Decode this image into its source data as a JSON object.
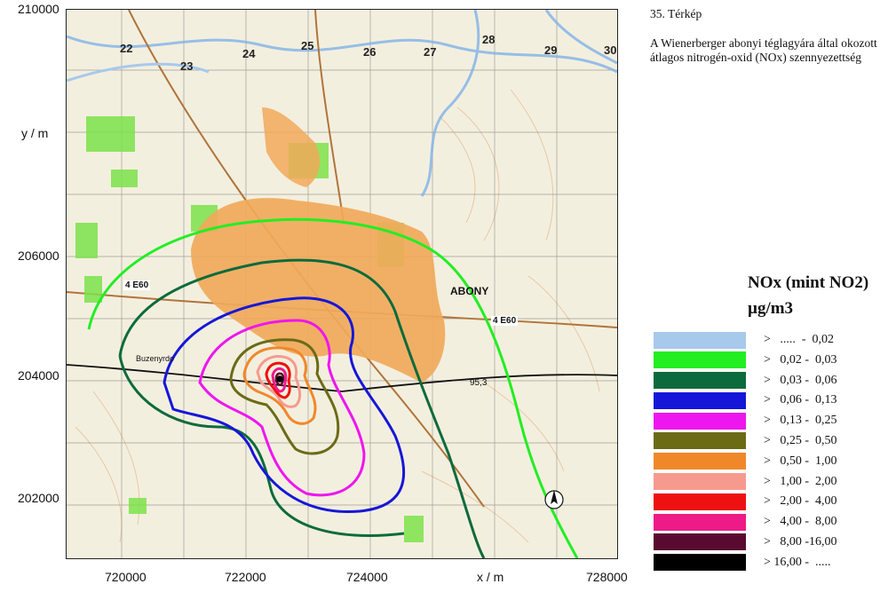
{
  "map": {
    "title_number": "35. Térkép",
    "description": "A Wienerberger abonyi téglagyára által okozott átlagos nitrogén-oxid (NOx) szennyezettség",
    "y_axis": {
      "label": "y / m",
      "ticks": [
        "210000",
        "206000",
        "204000",
        "202000"
      ]
    },
    "x_axis": {
      "label": "x / m",
      "ticks": [
        "720000",
        "722000",
        "724000",
        "728000"
      ]
    },
    "grid_numbers": [
      "22",
      "23",
      "24",
      "25",
      "26",
      "27",
      "28",
      "29",
      "30"
    ],
    "place_labels": {
      "town": "ABONY",
      "road_1": "4 E60",
      "road_2": "4 E60",
      "area": "Buzenyrdo",
      "spot_height": "95,3"
    }
  },
  "legend": {
    "title": "NOx (mint NO2)",
    "unit": "µg/m3",
    "items": [
      {
        "label": ">   .....  -  0,02",
        "color": "#a7c9ec"
      },
      {
        "label": ">   0,02 -  0,03",
        "color": "#22ee22"
      },
      {
        "label": ">   0,03 -  0,06",
        "color": "#0c6b3c"
      },
      {
        "label": ">   0,06 -  0,13",
        "color": "#1616d8"
      },
      {
        "label": ">   0,13 -  0,25",
        "color": "#ee16ee"
      },
      {
        "label": ">   0,25 -  0,50",
        "color": "#6b6b16"
      },
      {
        "label": ">   0,50 -  1,00",
        "color": "#f0882a"
      },
      {
        "label": ">   1,00 -  2,00",
        "color": "#f69a8e"
      },
      {
        "label": ">   2,00 -  4,00",
        "color": "#ee1111"
      },
      {
        "label": ">   4,00 -  8,00",
        "color": "#ee1a88"
      },
      {
        "label": ">   8,00 -16,00",
        "color": "#5a0a30"
      },
      {
        "label": "> 16,00 -  .....",
        "color": "#000000"
      }
    ]
  }
}
